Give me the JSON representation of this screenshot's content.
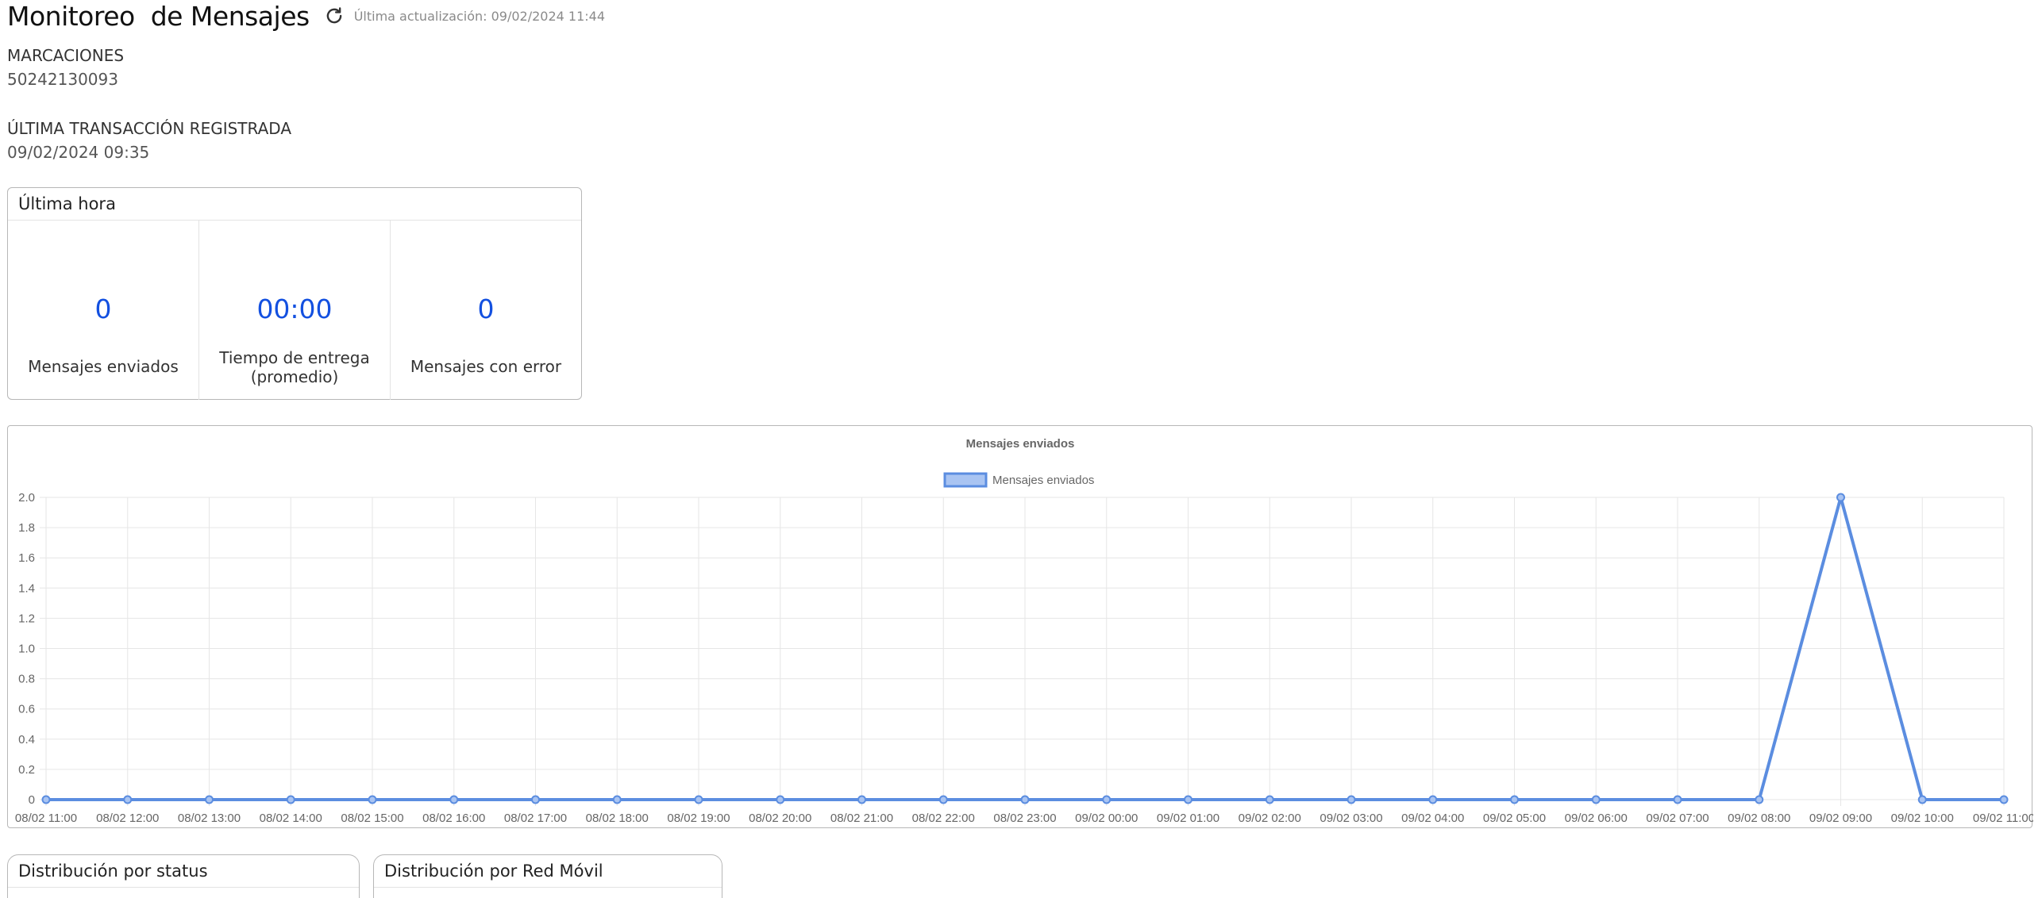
{
  "header": {
    "title": "Monitoreo  de Mensajes",
    "last_update": "Última actualización: 09/02/2024 11:44"
  },
  "info": {
    "marcaciones_label": "MARCACIONES",
    "marcaciones_value": "50242130093",
    "ultima_label": "ÚLTIMA TRANSACCIÓN REGISTRADA",
    "ultima_value": "09/02/2024 09:35"
  },
  "ultima_hora": {
    "title": "Última hora",
    "stats": [
      {
        "value": "0",
        "label": "Mensajes enviados"
      },
      {
        "value": "00:00",
        "label_line1": "Tiempo de entrega",
        "label_line2": "(promedio)"
      },
      {
        "value": "0",
        "label": "Mensajes con error"
      }
    ]
  },
  "chart_data": {
    "type": "line",
    "title": "Mensajes enviados",
    "legend": "top",
    "grid": true,
    "x": [
      "08/02 11:00",
      "08/02 12:00",
      "08/02 13:00",
      "08/02 14:00",
      "08/02 15:00",
      "08/02 16:00",
      "08/02 17:00",
      "08/02 18:00",
      "08/02 19:00",
      "08/02 20:00",
      "08/02 21:00",
      "08/02 22:00",
      "08/02 23:00",
      "09/02 00:00",
      "09/02 01:00",
      "09/02 02:00",
      "09/02 03:00",
      "09/02 04:00",
      "09/02 05:00",
      "09/02 06:00",
      "09/02 07:00",
      "09/02 08:00",
      "09/02 09:00",
      "09/02 10:00",
      "09/02 11:00"
    ],
    "series": [
      {
        "name": "Mensajes enviados",
        "values": [
          0,
          0,
          0,
          0,
          0,
          0,
          0,
          0,
          0,
          0,
          0,
          0,
          0,
          0,
          0,
          0,
          0,
          0,
          0,
          0,
          0,
          0,
          2,
          0,
          0
        ]
      }
    ],
    "ylim": [
      0,
      2
    ],
    "yticks": [
      "0",
      "0.2",
      "0.4",
      "0.6",
      "0.8",
      "1.0",
      "1.2",
      "1.4",
      "1.6",
      "1.8",
      "2.0"
    ],
    "colors": {
      "line": "#5b8de0",
      "fill": "#a9c4f2"
    }
  },
  "bottom_cards": {
    "status_title": "Distribución por status",
    "red_title": "Distribución por Red Móvil"
  },
  "icons": {
    "refresh": "refresh-icon"
  }
}
